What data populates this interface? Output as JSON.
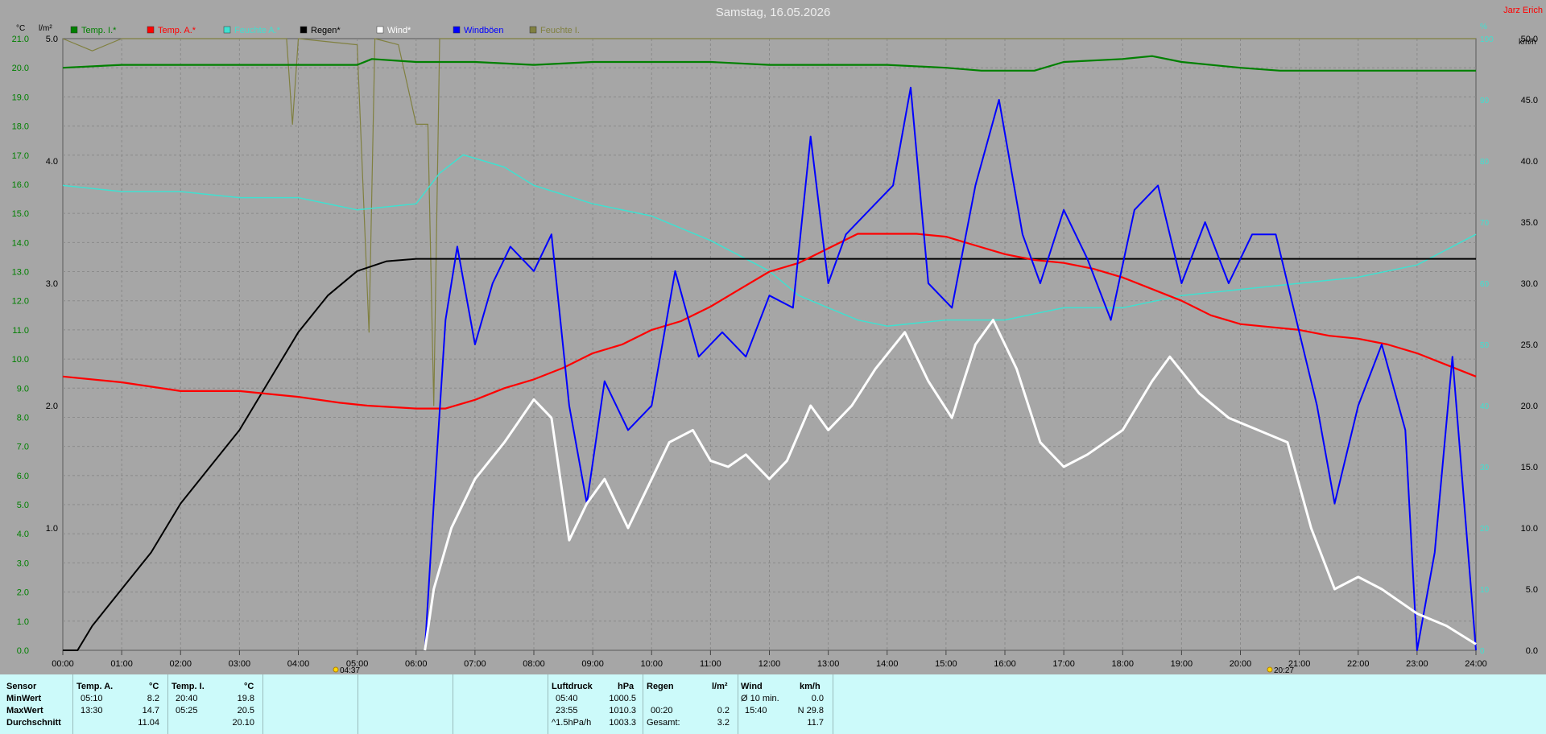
{
  "header": {
    "title": "Samstag, 16.05.2026",
    "author": "Jarz Erich",
    "unit_left": "°C",
    "unit_rain": "l/m²",
    "unit_pct": "%",
    "unit_kmh": "km/h"
  },
  "legend": [
    {
      "label": "Temp. I.*",
      "color": "#008000"
    },
    {
      "label": "Temp. A.*",
      "color": "#ff0000"
    },
    {
      "label": "Feuchte A.*",
      "color": "#40e0d0"
    },
    {
      "label": "Regen*",
      "color": "#000000"
    },
    {
      "label": "Wind*",
      "color": "#ffffff"
    },
    {
      "label": "Windböen",
      "color": "#0000ff"
    },
    {
      "label": "Feuchte I.",
      "color": "#808040"
    }
  ],
  "sun": {
    "rise": "04:37",
    "set": "20:27"
  },
  "table": {
    "col_labels": [
      "Sensor",
      "MinWert",
      "MaxWert",
      "Durchschnitt"
    ],
    "temp_a": {
      "head": "Temp. A.",
      "unit": "°C",
      "min_time": "05:10",
      "min": "8.2",
      "max_time": "13:30",
      "max": "14.7",
      "avg": "11.04"
    },
    "temp_i": {
      "head": "Temp. I.",
      "unit": "°C",
      "min_time": "20:40",
      "min": "19.8",
      "max_time": "05:25",
      "max": "20.5",
      "avg": "20.10"
    },
    "pressure": {
      "head": "Luftdruck",
      "unit": "hPa",
      "min_time": "05:40",
      "min": "1000.5",
      "max_time": "23:55",
      "max": "1010.3",
      "trend_label": "^1.5hPa/h",
      "avg": "1003.3"
    },
    "rain": {
      "head": "Regen",
      "unit": "l/m²",
      "max_time": "00:20",
      "max": "0.2",
      "total_label": "Gesamt:",
      "total": "3.2"
    },
    "wind": {
      "head": "Wind",
      "unit": "km/h",
      "min_label": "Ø 10 min.",
      "min": "0.0",
      "max_time": "15:40",
      "max": "N 29.8",
      "avg": "11.7"
    }
  },
  "chart_data": {
    "type": "line",
    "title": "Samstag, 16.05.2026",
    "x_ticks": [
      "00:00",
      "01:00",
      "02:00",
      "03:00",
      "04:00",
      "05:00",
      "06:00",
      "07:00",
      "08:00",
      "09:00",
      "10:00",
      "11:00",
      "12:00",
      "13:00",
      "14:00",
      "15:00",
      "16:00",
      "17:00",
      "18:00",
      "19:00",
      "20:00",
      "21:00",
      "22:00",
      "23:00",
      "24:00"
    ],
    "x_range_hours": [
      0,
      24
    ],
    "axes": {
      "temperature": {
        "unit": "°C",
        "range": [
          0,
          21
        ],
        "ticks": [
          "0.0",
          "1.0",
          "2.0",
          "3.0",
          "4.0",
          "5.0",
          "6.0",
          "7.0",
          "8.0",
          "9.0",
          "10.0",
          "11.0",
          "12.0",
          "13.0",
          "14.0",
          "15.0",
          "16.0",
          "17.0",
          "18.0",
          "19.0",
          "20.0",
          "21.0"
        ]
      },
      "rain": {
        "unit": "l/m²",
        "range": [
          0,
          5
        ],
        "ticks": [
          "1.0",
          "2.0",
          "3.0",
          "4.0",
          "5.0"
        ]
      },
      "humidity": {
        "unit": "%",
        "range": [
          0,
          100
        ],
        "ticks": [
          "0",
          "10",
          "20",
          "30",
          "40",
          "50",
          "60",
          "70",
          "80",
          "90",
          "100"
        ]
      },
      "wind": {
        "unit": "km/h",
        "range": [
          0,
          50
        ],
        "ticks": [
          "0.0",
          "5.0",
          "10.0",
          "15.0",
          "20.0",
          "25.0",
          "30.0",
          "35.0",
          "40.0",
          "45.0",
          "50.0"
        ]
      }
    },
    "grid": true,
    "series": [
      {
        "name": "Temp. I.*",
        "color": "#008000",
        "axis": "temperature",
        "points": [
          [
            0,
            20.0
          ],
          [
            1,
            20.1
          ],
          [
            2,
            20.1
          ],
          [
            3,
            20.1
          ],
          [
            4,
            20.1
          ],
          [
            5,
            20.1
          ],
          [
            5.25,
            20.3
          ],
          [
            6,
            20.2
          ],
          [
            7,
            20.2
          ],
          [
            8,
            20.1
          ],
          [
            9,
            20.2
          ],
          [
            10,
            20.2
          ],
          [
            11,
            20.2
          ],
          [
            12,
            20.1
          ],
          [
            13,
            20.1
          ],
          [
            14,
            20.1
          ],
          [
            15,
            20.0
          ],
          [
            15.6,
            19.9
          ],
          [
            16.5,
            19.9
          ],
          [
            17,
            20.2
          ],
          [
            18,
            20.3
          ],
          [
            18.5,
            20.4
          ],
          [
            19,
            20.2
          ],
          [
            20,
            20.0
          ],
          [
            20.67,
            19.9
          ],
          [
            22,
            19.9
          ],
          [
            24,
            19.9
          ]
        ]
      },
      {
        "name": "Temp. A.*",
        "color": "#ff0000",
        "axis": "temperature",
        "points": [
          [
            0,
            9.4
          ],
          [
            1,
            9.2
          ],
          [
            2,
            8.9
          ],
          [
            3,
            8.9
          ],
          [
            4,
            8.7
          ],
          [
            4.7,
            8.5
          ],
          [
            5.17,
            8.4
          ],
          [
            6,
            8.3
          ],
          [
            6.5,
            8.3
          ],
          [
            7,
            8.6
          ],
          [
            7.5,
            9.0
          ],
          [
            8,
            9.3
          ],
          [
            8.5,
            9.7
          ],
          [
            9,
            10.2
          ],
          [
            9.5,
            10.5
          ],
          [
            10,
            11.0
          ],
          [
            10.5,
            11.3
          ],
          [
            11,
            11.8
          ],
          [
            11.5,
            12.4
          ],
          [
            12,
            13.0
          ],
          [
            12.5,
            13.3
          ],
          [
            13,
            13.8
          ],
          [
            13.5,
            14.3
          ],
          [
            14,
            14.3
          ],
          [
            14.5,
            14.3
          ],
          [
            15,
            14.2
          ],
          [
            15.5,
            13.9
          ],
          [
            16,
            13.6
          ],
          [
            16.5,
            13.4
          ],
          [
            17,
            13.3
          ],
          [
            17.5,
            13.1
          ],
          [
            18,
            12.8
          ],
          [
            18.5,
            12.4
          ],
          [
            19,
            12.0
          ],
          [
            19.5,
            11.5
          ],
          [
            20,
            11.2
          ],
          [
            20.5,
            11.1
          ],
          [
            21,
            11.0
          ],
          [
            21.5,
            10.8
          ],
          [
            22,
            10.7
          ],
          [
            22.5,
            10.5
          ],
          [
            23,
            10.2
          ],
          [
            23.5,
            9.8
          ],
          [
            24,
            9.4
          ]
        ]
      },
      {
        "name": "Feuchte A.*",
        "color": "#40e0d0",
        "axis": "humidity",
        "points": [
          [
            0,
            76
          ],
          [
            1,
            75
          ],
          [
            2,
            75
          ],
          [
            3,
            74
          ],
          [
            4,
            74
          ],
          [
            5,
            72
          ],
          [
            6,
            73
          ],
          [
            6.4,
            78
          ],
          [
            6.8,
            81
          ],
          [
            7.5,
            79
          ],
          [
            8,
            76
          ],
          [
            9,
            73
          ],
          [
            10,
            71
          ],
          [
            11,
            67
          ],
          [
            12,
            62
          ],
          [
            12.5,
            58
          ],
          [
            13,
            56
          ],
          [
            13.5,
            54
          ],
          [
            14,
            53
          ],
          [
            15,
            54
          ],
          [
            16,
            54
          ],
          [
            17,
            56
          ],
          [
            18,
            56
          ],
          [
            19,
            58
          ],
          [
            20,
            59
          ],
          [
            21,
            60
          ],
          [
            22,
            61
          ],
          [
            23,
            63
          ],
          [
            24,
            68
          ]
        ]
      },
      {
        "name": "Regen*",
        "color": "#000000",
        "axis": "rain",
        "points": [
          [
            0,
            0
          ],
          [
            0.25,
            0
          ],
          [
            0.5,
            0.2
          ],
          [
            1,
            0.5
          ],
          [
            1.5,
            0.8
          ],
          [
            2,
            1.2
          ],
          [
            2.5,
            1.5
          ],
          [
            3,
            1.8
          ],
          [
            3.5,
            2.2
          ],
          [
            4,
            2.6
          ],
          [
            4.5,
            2.9
          ],
          [
            5,
            3.1
          ],
          [
            5.5,
            3.18
          ],
          [
            6,
            3.2
          ],
          [
            24,
            3.2
          ]
        ]
      },
      {
        "name": "Wind*",
        "color": "#ffffff",
        "axis": "wind",
        "points": [
          [
            6.15,
            0
          ],
          [
            6.3,
            5
          ],
          [
            6.6,
            10
          ],
          [
            7,
            14
          ],
          [
            7.5,
            17
          ],
          [
            8,
            20.5
          ],
          [
            8.3,
            19
          ],
          [
            8.6,
            9
          ],
          [
            8.9,
            12
          ],
          [
            9.2,
            14
          ],
          [
            9.6,
            10
          ],
          [
            10,
            14
          ],
          [
            10.3,
            17
          ],
          [
            10.7,
            18
          ],
          [
            11,
            15.5
          ],
          [
            11.3,
            15
          ],
          [
            11.6,
            16
          ],
          [
            12,
            14
          ],
          [
            12.3,
            15.5
          ],
          [
            12.7,
            20
          ],
          [
            13,
            18
          ],
          [
            13.4,
            20
          ],
          [
            13.8,
            23
          ],
          [
            14.3,
            26
          ],
          [
            14.7,
            22
          ],
          [
            15.1,
            19
          ],
          [
            15.5,
            25
          ],
          [
            15.8,
            27
          ],
          [
            16.2,
            23
          ],
          [
            16.6,
            17
          ],
          [
            17,
            15
          ],
          [
            17.4,
            16
          ],
          [
            18,
            18
          ],
          [
            18.5,
            22
          ],
          [
            18.8,
            24
          ],
          [
            19.3,
            21
          ],
          [
            19.8,
            19
          ],
          [
            20.3,
            18
          ],
          [
            20.8,
            17
          ],
          [
            21.2,
            10
          ],
          [
            21.6,
            5
          ],
          [
            22,
            6
          ],
          [
            22.4,
            5
          ],
          [
            23,
            3
          ],
          [
            23.5,
            2
          ],
          [
            24,
            0.5
          ]
        ]
      },
      {
        "name": "Windböen",
        "color": "#0000ff",
        "axis": "wind",
        "points": [
          [
            6.15,
            0
          ],
          [
            6.3,
            12
          ],
          [
            6.5,
            27
          ],
          [
            6.7,
            33
          ],
          [
            7,
            25
          ],
          [
            7.3,
            30
          ],
          [
            7.6,
            33
          ],
          [
            8,
            31
          ],
          [
            8.3,
            34
          ],
          [
            8.6,
            20
          ],
          [
            8.9,
            12
          ],
          [
            9.2,
            22
          ],
          [
            9.6,
            18
          ],
          [
            10,
            20
          ],
          [
            10.4,
            31
          ],
          [
            10.8,
            24
          ],
          [
            11.2,
            26
          ],
          [
            11.6,
            24
          ],
          [
            12,
            29
          ],
          [
            12.4,
            28
          ],
          [
            12.7,
            42
          ],
          [
            13,
            30
          ],
          [
            13.3,
            34
          ],
          [
            13.7,
            36
          ],
          [
            14.1,
            38
          ],
          [
            14.4,
            46
          ],
          [
            14.7,
            30
          ],
          [
            15.1,
            28
          ],
          [
            15.5,
            38
          ],
          [
            15.9,
            45
          ],
          [
            16.3,
            34
          ],
          [
            16.6,
            30
          ],
          [
            17,
            36
          ],
          [
            17.4,
            32
          ],
          [
            17.8,
            27
          ],
          [
            18.2,
            36
          ],
          [
            18.6,
            38
          ],
          [
            19,
            30
          ],
          [
            19.4,
            35
          ],
          [
            19.8,
            30
          ],
          [
            20.2,
            34
          ],
          [
            20.6,
            34
          ],
          [
            21,
            26
          ],
          [
            21.3,
            20
          ],
          [
            21.6,
            12
          ],
          [
            22,
            20
          ],
          [
            22.4,
            25
          ],
          [
            22.8,
            18
          ],
          [
            23,
            0
          ],
          [
            23.3,
            8
          ],
          [
            23.6,
            24
          ],
          [
            24,
            0
          ]
        ]
      },
      {
        "name": "Feuchte I.",
        "color": "#808040",
        "axis": "humidity",
        "points": [
          [
            0,
            100
          ],
          [
            0.5,
            98
          ],
          [
            1,
            100
          ],
          [
            3,
            100
          ],
          [
            3.8,
            100
          ],
          [
            3.9,
            86
          ],
          [
            4,
            100
          ],
          [
            5,
            99
          ],
          [
            5.2,
            52
          ],
          [
            5.3,
            100
          ],
          [
            5.7,
            99
          ],
          [
            6,
            86
          ],
          [
            6.2,
            86
          ],
          [
            6.3,
            40
          ],
          [
            6.4,
            100
          ],
          [
            7,
            100
          ],
          [
            12,
            100
          ],
          [
            17,
            100
          ],
          [
            24,
            100
          ]
        ]
      }
    ]
  }
}
